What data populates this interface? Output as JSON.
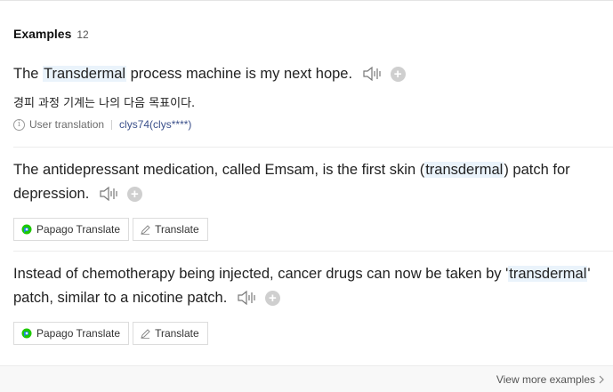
{
  "header": {
    "title": "Examples",
    "count": "12"
  },
  "examples": [
    {
      "before": "The ",
      "highlight": "Transdermal",
      "after": " process machine is my next hope.",
      "translation": "경피 과정 기계는 나의 다음 목표이다.",
      "source_label": "User translation",
      "source_user": "clys74(clys****)"
    },
    {
      "before": "The antidepressant medication, called Emsam, is the first skin (",
      "highlight": "transdermal",
      "after": ") patch for depression.",
      "buttons": {
        "papago": "Papago Translate",
        "translate": "Translate"
      }
    },
    {
      "before": "Instead of chemotherapy being injected, cancer drugs can now be taken by '",
      "highlight": "transdermal",
      "after": "' patch, similar to a nicotine patch.",
      "buttons": {
        "papago": "Papago Translate",
        "translate": "Translate"
      }
    }
  ],
  "footer": {
    "more_label": "View more examples"
  },
  "icons": {
    "speaker": "speaker-icon",
    "plus": "add-plus-icon",
    "info": "info-icon",
    "papago": "papago-logo-icon",
    "pen": "pen-icon",
    "chevron": "chevron-right-icon"
  },
  "colors": {
    "highlight_bg": "#eaf3fb",
    "papago_green": "#1ec800",
    "papago_blue": "#1a8ad4",
    "user_link": "#3a4f8a"
  }
}
